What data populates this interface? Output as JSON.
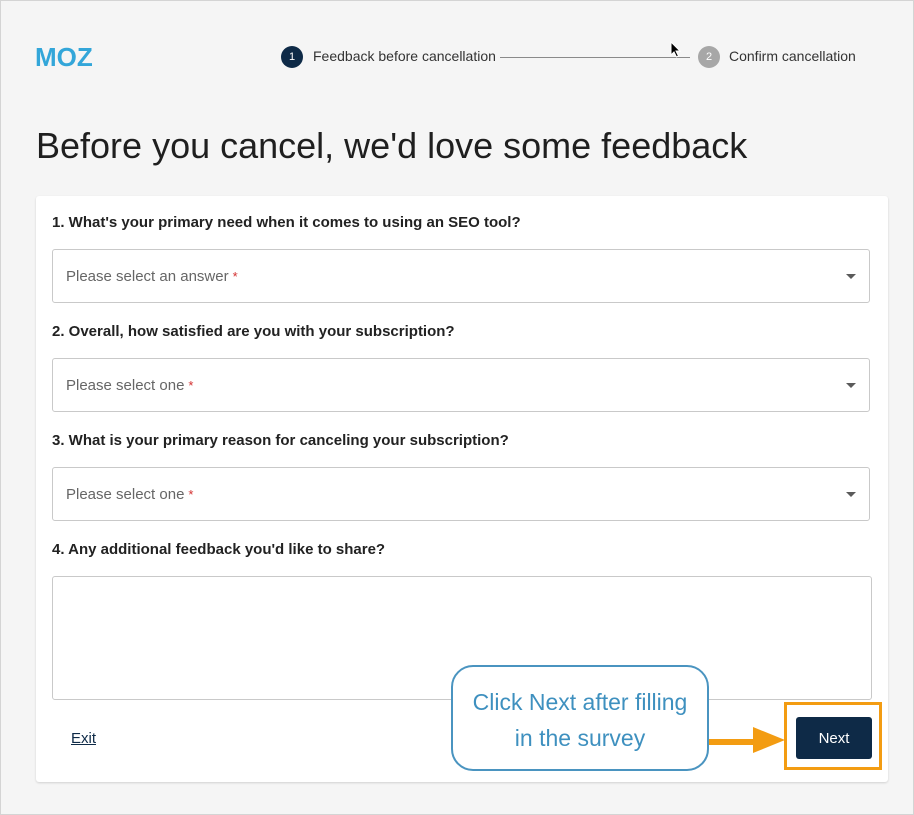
{
  "brand": {
    "logo_text": "MOZ",
    "logo_color": "#33a6d9"
  },
  "stepper": {
    "steps": [
      {
        "number": "1",
        "label": "Feedback before cancellation",
        "state": "active"
      },
      {
        "number": "2",
        "label": "Confirm cancellation",
        "state": "inactive"
      }
    ]
  },
  "page": {
    "title": "Before you cancel, we'd love some feedback"
  },
  "form": {
    "questions": [
      {
        "label": "1. What's your primary need when it comes to using an SEO tool?",
        "placeholder": "Please select an answer",
        "required_mark": "*"
      },
      {
        "label": "2. Overall, how satisfied are you with your subscription?",
        "placeholder": "Please select one",
        "required_mark": "*"
      },
      {
        "label": "3. What is your primary reason for canceling your subscription?",
        "placeholder": "Please select one",
        "required_mark": "*"
      },
      {
        "label": "4. Any additional feedback you'd like to share?",
        "value": ""
      }
    ],
    "exit_label": "Exit",
    "next_label": "Next"
  },
  "annotation": {
    "callout_text_line1": "Click Next after filling",
    "callout_text_line2": "in the survey",
    "callout_color": "#4a94c0",
    "highlight_color": "#f39c12"
  },
  "colors": {
    "primary": "#0e2a47",
    "required": "#d32f2f"
  }
}
